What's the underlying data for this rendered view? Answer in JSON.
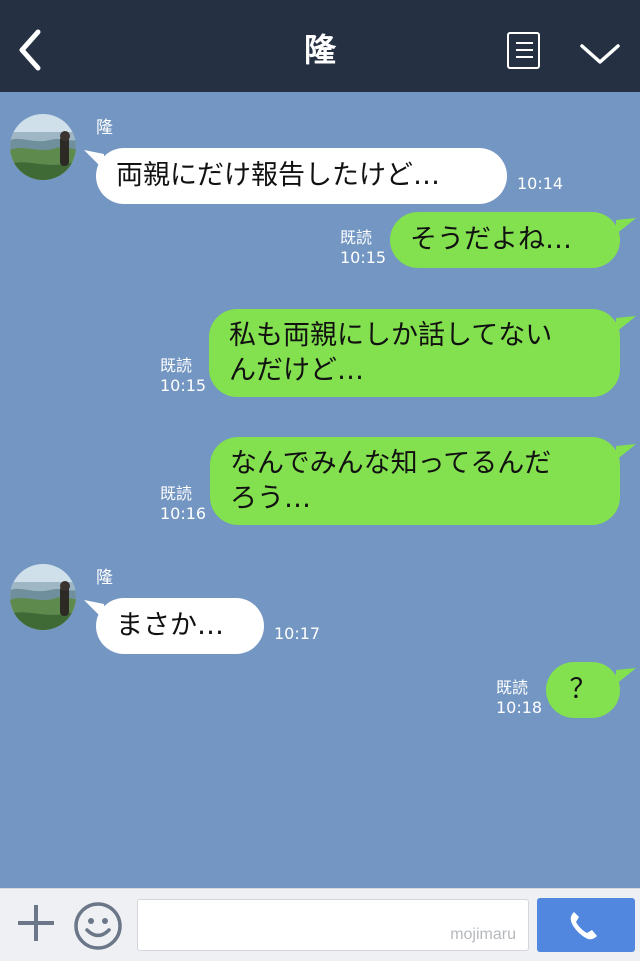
{
  "header": {
    "title": "隆",
    "back_icon": "chevron-left-icon",
    "menu_icon": "list-menu-icon",
    "collapse_icon": "chevron-down-icon"
  },
  "messages": [
    {
      "side": "in",
      "sender": "隆",
      "lines": [
        "両親にだけ報告したけど…"
      ],
      "time": "10:14"
    },
    {
      "side": "out",
      "read": "既読",
      "lines": [
        "そうだよね…"
      ],
      "time": "10:15"
    },
    {
      "side": "out",
      "read": "既読",
      "lines": [
        "私も両親にしか話してない",
        "んだけど…"
      ],
      "time": "10:15"
    },
    {
      "side": "out",
      "read": "既読",
      "lines": [
        "なんでみんな知ってるんだ",
        "ろう…"
      ],
      "time": "10:16"
    },
    {
      "side": "in",
      "sender": "隆",
      "lines": [
        "まさか…"
      ],
      "time": "10:17"
    },
    {
      "side": "out",
      "read": "既読",
      "lines": [
        "？"
      ],
      "time": "10:18"
    }
  ],
  "footer": {
    "plus_icon": "plus-icon",
    "emoji_icon": "smiley-icon",
    "input_value": "",
    "watermark": "mojimaru",
    "call_icon": "phone-icon"
  },
  "colors": {
    "header_bg": "#253142",
    "chat_bg": "#7396c2",
    "outgoing_bubble": "#83e04f",
    "incoming_bubble": "#ffffff",
    "call_button": "#5187de"
  }
}
